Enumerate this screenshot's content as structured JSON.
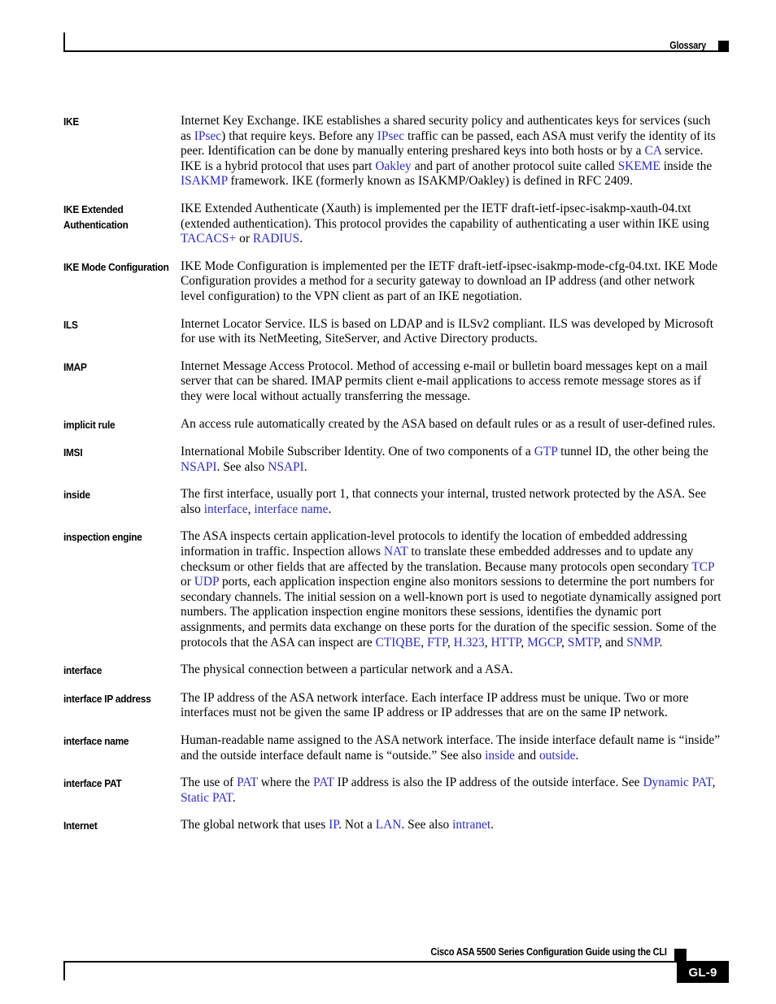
{
  "header": {
    "section_label": "Glossary",
    "marker_icon": "black-square-icon"
  },
  "footer": {
    "guide_title": "Cisco ASA 5500 Series Configuration Guide using the CLI",
    "marker_icon": "black-square-icon",
    "page_number": "GL-9"
  },
  "colors": {
    "link": "#2a2ad0",
    "text": "#000000",
    "background": "#ffffff"
  },
  "glossary": {
    "entries": [
      {
        "term": "IKE",
        "definition_html": "Internet Key Exchange. IKE establishes a shared security policy and authenticates keys for services (such as <span class=\"lnk\" data-name=\"xref-link\" data-interactable=\"true\">IPsec</span>) that require keys. Before any <span class=\"lnk\" data-name=\"xref-link\" data-interactable=\"true\">IPsec</span> traffic can be passed, each ASA must verify the identity of its peer. Identification can be done by manually entering preshared keys into both hosts or by a <span class=\"lnk\" data-name=\"xref-link\" data-interactable=\"true\">CA</span> service. IKE is a hybrid protocol that uses part <span class=\"lnk\" data-name=\"xref-link\" data-interactable=\"true\">Oakley</span> and part of another protocol suite called <span class=\"lnk\" data-name=\"xref-link\" data-interactable=\"true\">SKEME</span> inside the <span class=\"lnk\" data-name=\"xref-link\" data-interactable=\"true\">ISAKMP</span> framework. IKE (formerly known as ISAKMP/Oakley) is defined in RFC 2409."
      },
      {
        "term": "IKE Extended Authentication",
        "definition_html": "IKE Extended Authenticate (Xauth) is implemented per the IETF draft-ietf-ipsec-isakmp-xauth-04.txt (extended authentication). This protocol provides the capability of authenticating a user within IKE using <span class=\"lnk\" data-name=\"xref-link\" data-interactable=\"true\">TACACS+</span> or <span class=\"lnk\" data-name=\"xref-link\" data-interactable=\"true\">RADIUS</span>."
      },
      {
        "term": "IKE Mode Configuration",
        "definition_html": "IKE Mode Configuration is implemented per the IETF draft-ietf-ipsec-isakmp-mode-cfg-04.txt. IKE Mode Configuration provides a method for a security gateway to download an IP address (and other network level configuration) to the VPN client as part of an IKE negotiation."
      },
      {
        "term": "ILS",
        "definition_html": "Internet Locator Service. ILS is based on LDAP and is ILSv2 compliant. ILS was developed by Microsoft for use with its NetMeeting, SiteServer, and Active Directory products."
      },
      {
        "term": "IMAP",
        "definition_html": "Internet Message Access Protocol. Method of accessing e-mail or bulletin board messages kept on a mail server that can be shared. IMAP permits client e-mail applications to access remote message stores as if they were local without actually transferring the message."
      },
      {
        "term": "implicit rule",
        "definition_html": "An access rule automatically created by the ASA based on default rules or as a result of user-defined rules."
      },
      {
        "term": "IMSI",
        "definition_html": "International Mobile Subscriber Identity. One of two components of a <span class=\"lnk\" data-name=\"xref-link\" data-interactable=\"true\">GTP</span> tunnel ID, the other being the <span class=\"lnk\" data-name=\"xref-link\" data-interactable=\"true\">NSAPI</span>. See also <span class=\"lnk\" data-name=\"xref-link\" data-interactable=\"true\">NSAPI</span>."
      },
      {
        "term": "inside",
        "definition_html": "The first interface, usually port 1, that connects your internal, trusted network protected by the ASA. See also <span class=\"lnk\" data-name=\"xref-link\" data-interactable=\"true\">interface</span>, <span class=\"lnk\" data-name=\"xref-link\" data-interactable=\"true\">interface name</span>."
      },
      {
        "term": "inspection engine",
        "definition_html": "The ASA inspects certain application-level protocols to identify the location of embedded addressing information in traffic. Inspection allows <span class=\"lnk\" data-name=\"xref-link\" data-interactable=\"true\">NAT</span> to translate these embedded addresses and to update any checksum or other fields that are affected by the translation. Because many protocols open secondary <span class=\"lnk\" data-name=\"xref-link\" data-interactable=\"true\">TCP</span> or <span class=\"lnk\" data-name=\"xref-link\" data-interactable=\"true\">UDP</span> ports, each application inspection engine also monitors sessions to determine the port numbers for secondary channels. The initial session on a well-known port is used to negotiate dynamically assigned port numbers. The application inspection engine monitors these sessions, identifies the dynamic port assignments, and permits data exchange on these ports for the duration of the specific session. Some of the protocols that the ASA can inspect are <span class=\"lnk\" data-name=\"xref-link\" data-interactable=\"true\">CTIQBE</span>, <span class=\"lnk\" data-name=\"xref-link\" data-interactable=\"true\">FTP</span>, <span class=\"lnk\" data-name=\"xref-link\" data-interactable=\"true\">H.323</span>, <span class=\"lnk\" data-name=\"xref-link\" data-interactable=\"true\">HTTP</span>, <span class=\"lnk\" data-name=\"xref-link\" data-interactable=\"true\">MGCP</span>, <span class=\"lnk\" data-name=\"xref-link\" data-interactable=\"true\">SMTP</span>, and <span class=\"lnk\" data-name=\"xref-link\" data-interactable=\"true\">SNMP</span>."
      },
      {
        "term": "interface",
        "definition_html": "The physical connection between a particular network and a ASA."
      },
      {
        "term": "interface IP address",
        "definition_html": "The IP address of the ASA network interface. Each interface IP address must be unique. Two or more interfaces must not be given the same IP address or IP addresses that are on the same IP network."
      },
      {
        "term": "interface name",
        "definition_html": "Human-readable name assigned to the ASA network interface. The inside interface default name is &ldquo;inside&rdquo; and the outside interface default name is &ldquo;outside.&rdquo; See also <span class=\"lnk\" data-name=\"xref-link\" data-interactable=\"true\">inside</span> and <span class=\"lnk\" data-name=\"xref-link\" data-interactable=\"true\">outside</span>."
      },
      {
        "term": "interface PAT",
        "definition_html": "The use of <span class=\"lnk\" data-name=\"xref-link\" data-interactable=\"true\">PAT</span> where the <span class=\"lnk\" data-name=\"xref-link\" data-interactable=\"true\">PAT</span> IP address is also the IP address of the outside interface. See <span class=\"lnk\" data-name=\"xref-link\" data-interactable=\"true\">Dynamic PAT</span>, <span class=\"lnk\" data-name=\"xref-link\" data-interactable=\"true\">Static PAT</span>."
      },
      {
        "term": "Internet",
        "definition_html": "The global network that uses <span class=\"lnk\" data-name=\"xref-link\" data-interactable=\"true\">IP</span>. Not a <span class=\"lnk\" data-name=\"xref-link\" data-interactable=\"true\">LAN</span>. See also <span class=\"lnk\" data-name=\"xref-link\" data-interactable=\"true\">intranet</span>."
      }
    ]
  }
}
